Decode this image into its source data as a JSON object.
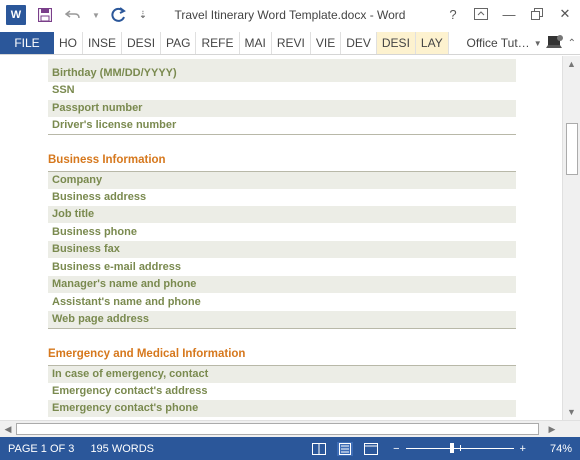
{
  "app": {
    "title": "Travel Itinerary Word Template.docx - Word",
    "logo": "W",
    "accent": "#2b579a"
  },
  "ribbon": {
    "file": "FILE",
    "tabs": [
      "HO",
      "INSE",
      "DESI",
      "PAG",
      "REFE",
      "MAI",
      "REVI",
      "VIE",
      "DEV",
      "DESI",
      "LAY"
    ],
    "user": "Office Tut…"
  },
  "document": {
    "personal_rows": [
      "Birthday (MM/DD/YYYY)",
      "SSN",
      "Passport number",
      "Driver's license number"
    ],
    "business": {
      "title": "Business Information",
      "rows": [
        "Company",
        "Business address",
        "Job title",
        "Business phone",
        "Business fax",
        "Business e-mail address",
        "Manager's name and phone",
        "Assistant's name and phone",
        "Web page address"
      ]
    },
    "emergency": {
      "title": "Emergency and Medical Information",
      "rows": [
        "In case of emergency, contact",
        "Emergency contact's address",
        "Emergency contact's phone"
      ]
    },
    "colors": {
      "heading": "#d6781d",
      "label": "#7a8a4f",
      "shade": "#ecede6"
    }
  },
  "status": {
    "page": "PAGE 1 OF 3",
    "words": "195 WORDS",
    "zoom": "74%",
    "zoom_minus": "−",
    "zoom_plus": "+"
  }
}
